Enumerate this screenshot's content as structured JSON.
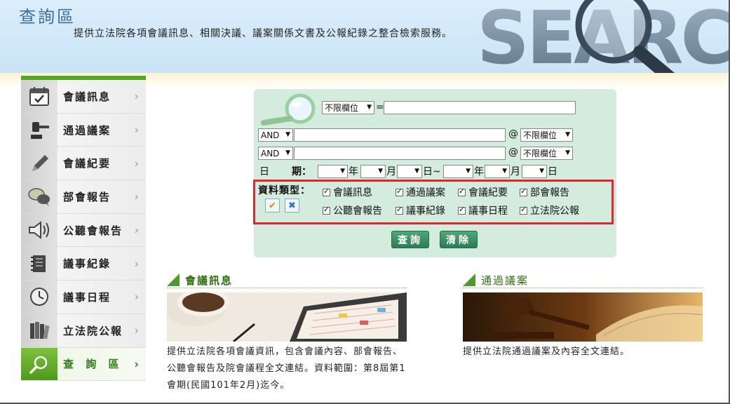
{
  "header": {
    "title": "查詢區",
    "description": "提供立法院各項會議訊息、相關決議、議案關係文書及公報紀錄之整合檢索服務。",
    "banner_word": "SEARCH"
  },
  "sidebar": {
    "items": [
      {
        "label": "會議訊息",
        "icon": "calendar-icon"
      },
      {
        "label": "通過議案",
        "icon": "gavel-icon"
      },
      {
        "label": "會議紀要",
        "icon": "pencil-icon"
      },
      {
        "label": "部會報告",
        "icon": "speech-bubbles-icon"
      },
      {
        "label": "公聽會報告",
        "icon": "megaphone-icon"
      },
      {
        "label": "議事紀錄",
        "icon": "notebook-icon"
      },
      {
        "label": "議事日程",
        "icon": "clock-icon"
      },
      {
        "label": "立法院公報",
        "icon": "books-icon"
      },
      {
        "label": "查 詢 區",
        "icon": "magnifier-icon",
        "active": true
      }
    ],
    "chevron": "›"
  },
  "search": {
    "field_select_1": "不限欄位",
    "equals": "=",
    "row2_op": "AND",
    "row2_at": "@",
    "row2_field": "不限欄位",
    "row3_op": "AND",
    "row3_at": "@",
    "row3_field": "不限欄位",
    "date_label_1": "日",
    "date_label_2": "期：",
    "year": "年",
    "month": "月",
    "day": "日",
    "tilde": "日~",
    "type_label": "資料類型：",
    "types": [
      "會議訊息",
      "通過議案",
      "會議紀要",
      "部會報告",
      "公聽會報告",
      "議事紀錄",
      "議事日程",
      "立法院公報"
    ],
    "search_button": "查詢",
    "clear_button": "清除"
  },
  "sections": {
    "meeting": {
      "title": "會議訊息",
      "description": "提供立法院各項會議資訊，包含會議內容、部會報告、公聽會報告及院會議程全文連結。資料範圍：第8屆第1會期(民國101年2月)迄今。"
    },
    "bills": {
      "title": "通過議案",
      "description": "提供立法院通過議案及內容全文連結。"
    }
  },
  "colors": {
    "accent_green": "#4f9a28",
    "panel_bg": "#d4ecdd",
    "highlight_red": "#e3262b",
    "header_blue": "#3d6ea3"
  }
}
